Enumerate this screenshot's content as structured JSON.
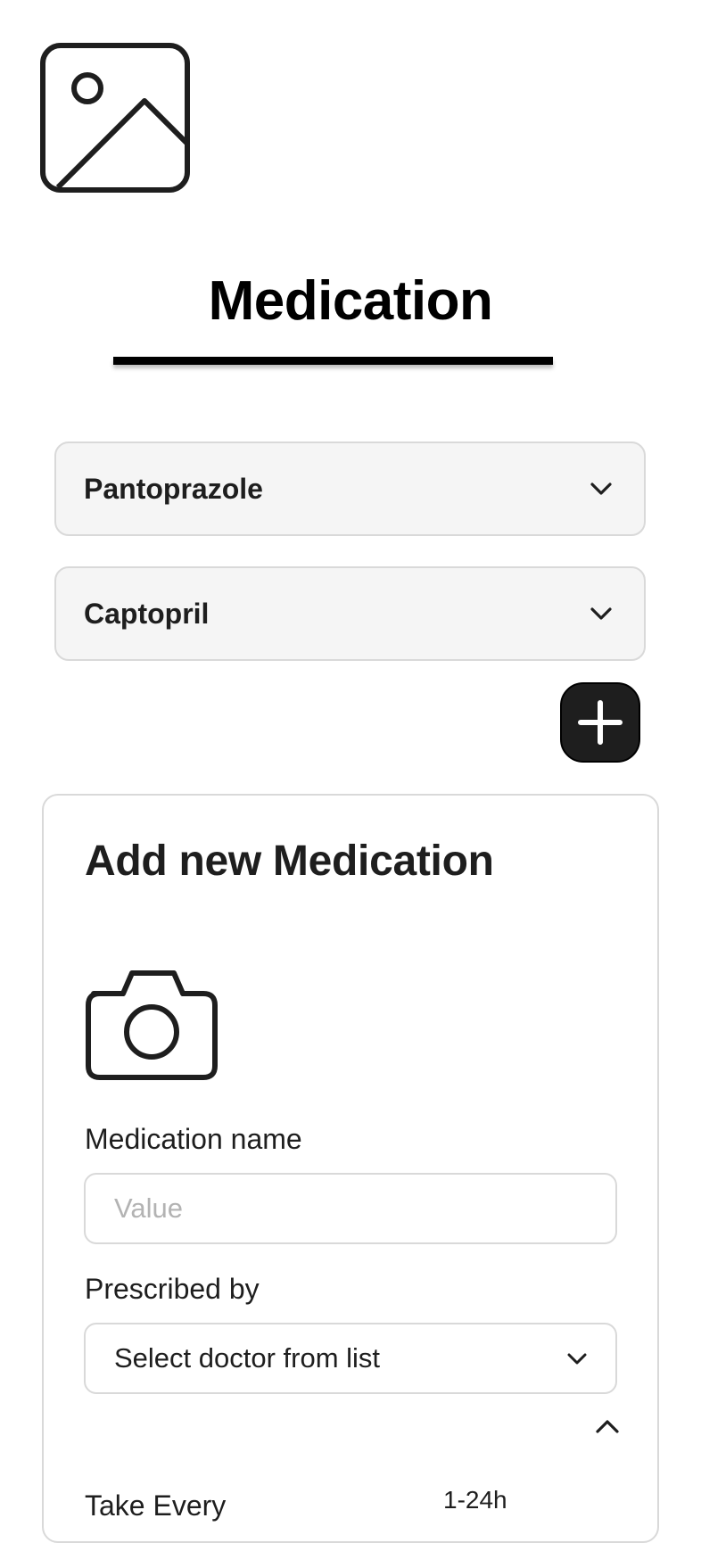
{
  "app": {
    "logo_icon": "image-placeholder-icon",
    "title": "Medication"
  },
  "medications": [
    {
      "name": "Pantoprazole",
      "icon": "chevron-down-icon"
    },
    {
      "name": "Captopril",
      "icon": "chevron-down-icon"
    }
  ],
  "add_button": {
    "icon": "plus-icon"
  },
  "form": {
    "heading": "Add new Medication",
    "camera_icon": "camera-icon",
    "medication_name": {
      "label": "Medication name",
      "placeholder": "Value",
      "value": ""
    },
    "prescribed_by": {
      "label": "Prescribed by",
      "selected": "Select doctor from list",
      "icon": "chevron-down-icon"
    },
    "collapse_icon": "chevron-up-icon",
    "take_every": {
      "label": "Take Every",
      "range_hint": "1-24h"
    }
  },
  "colors": {
    "text": "#1e1e1e",
    "row_background": "#f5f5f5",
    "border": "#d9d9d9",
    "button_background": "#1e1e1e",
    "placeholder": "#b3b3b3"
  }
}
